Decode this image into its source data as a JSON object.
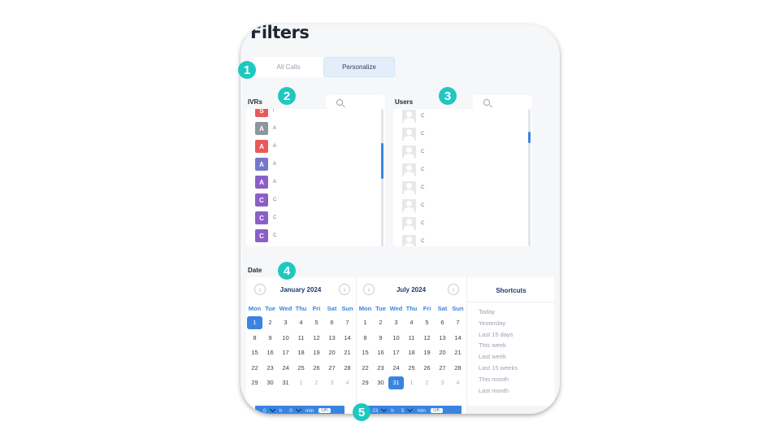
{
  "panel": {
    "title": "Filters"
  },
  "segment": {
    "tabs": [
      {
        "label": "All Calls",
        "active": false
      },
      {
        "label": "Personalize",
        "active": true
      }
    ]
  },
  "badges": [
    "1",
    "2",
    "3",
    "4",
    "5"
  ],
  "ivrs": {
    "label": "IVRs",
    "items": [
      {
        "letter": "S",
        "color": "#e85a5a",
        "text": "l"
      },
      {
        "letter": "A",
        "color": "#8d969e",
        "text": "A"
      },
      {
        "letter": "A",
        "color": "#e85a5a",
        "text": "A"
      },
      {
        "letter": "A",
        "color": "#7378c9",
        "text": "A"
      },
      {
        "letter": "A",
        "color": "#8a5fc9",
        "text": "A"
      },
      {
        "letter": "C",
        "color": "#8a5fc9",
        "text": "C"
      },
      {
        "letter": "C",
        "color": "#8a5fc9",
        "text": "C"
      },
      {
        "letter": "C",
        "color": "#8a5fc9",
        "text": "C"
      }
    ]
  },
  "users": {
    "label": "Users",
    "items": [
      {
        "text": "C"
      },
      {
        "text": "C"
      },
      {
        "text": "C"
      },
      {
        "text": "C"
      },
      {
        "text": "C"
      },
      {
        "text": "C"
      },
      {
        "text": "C"
      },
      {
        "text": "C"
      }
    ]
  },
  "date": {
    "label": "Date",
    "weekdays": [
      "Mon",
      "Tue",
      "Wed",
      "Thu",
      "Fri",
      "Sat",
      "Sun"
    ],
    "calendars": [
      {
        "title": "January 2024",
        "days": [
          [
            "1",
            "2",
            "3",
            "4",
            "5",
            "6",
            "7"
          ],
          [
            "8",
            "9",
            "10",
            "11",
            "12",
            "13",
            "14"
          ],
          [
            "15",
            "16",
            "17",
            "18",
            "19",
            "20",
            "21"
          ],
          [
            "22",
            "23",
            "24",
            "25",
            "26",
            "27",
            "28"
          ],
          [
            "29",
            "30",
            "31",
            "1",
            "2",
            "3",
            "4"
          ]
        ],
        "muted_from_index": 3,
        "selected": "1",
        "time": {
          "hour": "0",
          "hour_unit": "h",
          "minute": "0",
          "minute_unit": "min",
          "ok": "OK"
        }
      },
      {
        "title": "July 2024",
        "days": [
          [
            "1",
            "2",
            "3",
            "4",
            "5",
            "6",
            "7"
          ],
          [
            "8",
            "9",
            "10",
            "11",
            "12",
            "13",
            "14"
          ],
          [
            "15",
            "16",
            "17",
            "18",
            "19",
            "20",
            "21"
          ],
          [
            "22",
            "23",
            "24",
            "25",
            "26",
            "27",
            "28"
          ],
          [
            "29",
            "30",
            "31",
            "1",
            "2",
            "3",
            "4"
          ]
        ],
        "muted_from_index": 3,
        "selected": "31",
        "time": {
          "hour": "23",
          "hour_unit": "h",
          "minute": "5",
          "minute_unit": "min",
          "ok": "OK"
        }
      }
    ],
    "shortcuts": {
      "title": "Shortcuts",
      "items": [
        "Today",
        "Yesterday",
        "Last 15 days",
        "This week",
        "Last week",
        "Last 15 weeks",
        "This month",
        "Last month"
      ]
    }
  },
  "colors": {
    "accent": "#3a84e0",
    "badge": "#1ec8c0",
    "panel_bg": "#f6f7f9"
  },
  "icons": {
    "search": "search-icon",
    "prev": "chevron-left-icon",
    "next": "chevron-right-icon",
    "avatar": "user-avatar-icon"
  }
}
